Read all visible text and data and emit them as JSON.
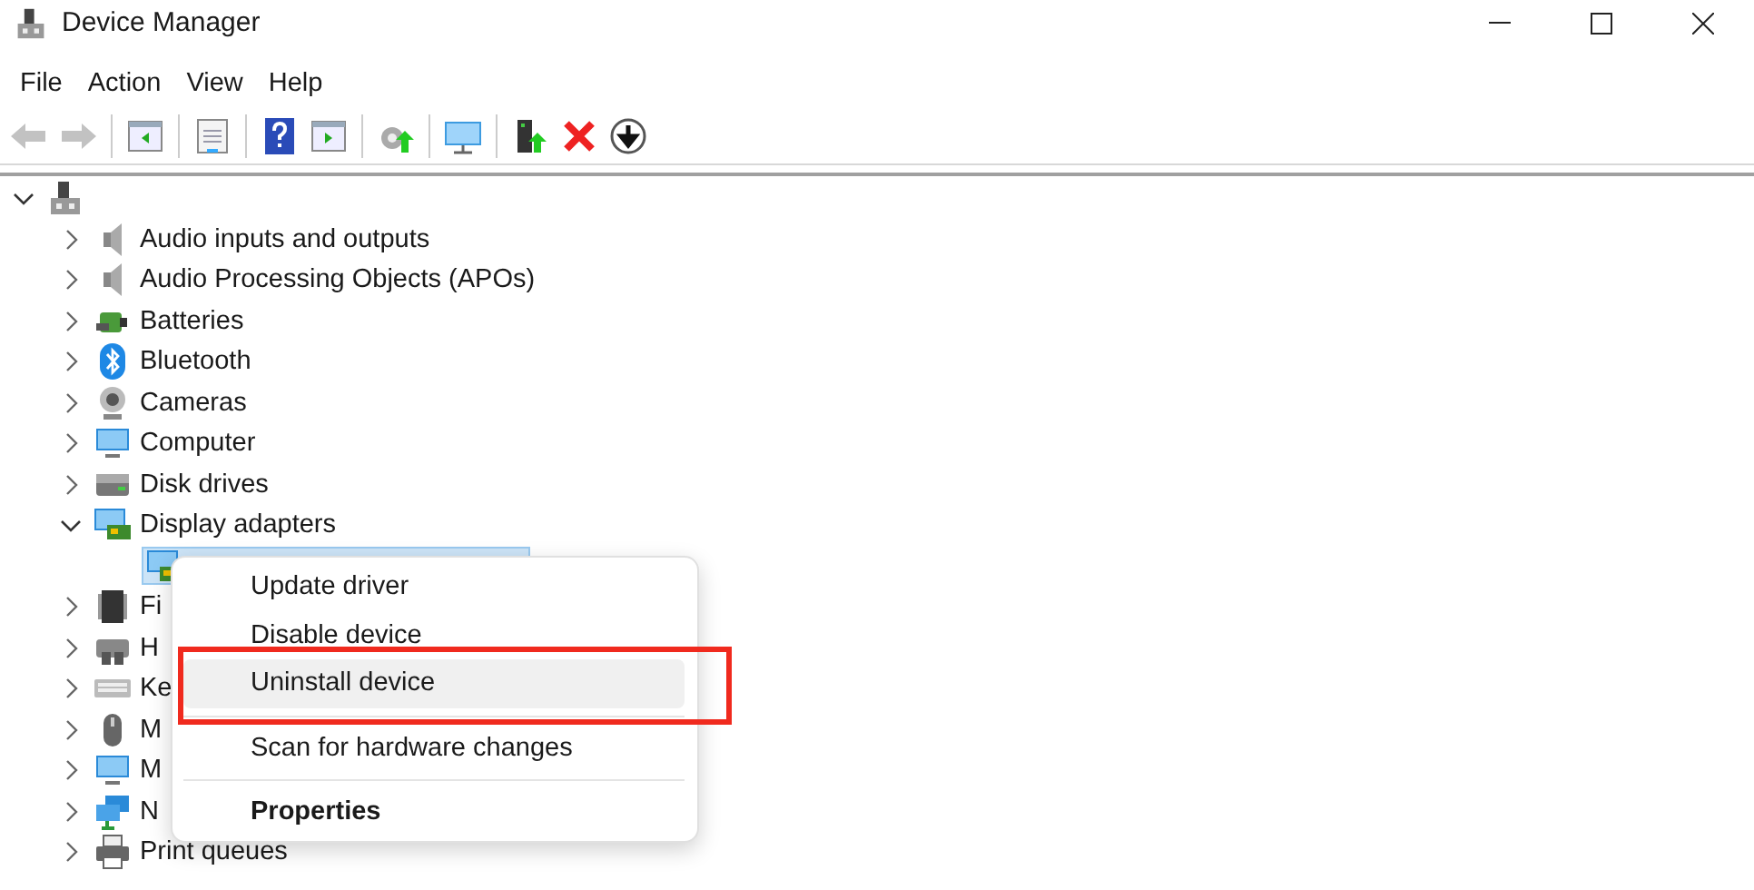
{
  "window": {
    "title": "Device Manager"
  },
  "menu_bar": [
    "File",
    "Action",
    "View",
    "Help"
  ],
  "toolbar": [
    {
      "kind": "back",
      "disabled": true
    },
    {
      "kind": "forward",
      "disabled": true
    },
    {
      "kind": "sep"
    },
    {
      "kind": "console-tree",
      "disabled": false
    },
    {
      "kind": "sep"
    },
    {
      "kind": "properties",
      "disabled": false
    },
    {
      "kind": "sep"
    },
    {
      "kind": "help",
      "disabled": false
    },
    {
      "kind": "action-pane",
      "disabled": false
    },
    {
      "kind": "sep"
    },
    {
      "kind": "update-driver",
      "disabled": false
    },
    {
      "kind": "sep"
    },
    {
      "kind": "scan",
      "disabled": false
    },
    {
      "kind": "sep"
    },
    {
      "kind": "enable",
      "disabled": false
    },
    {
      "kind": "uninstall",
      "disabled": false
    },
    {
      "kind": "disable",
      "disabled": false
    }
  ],
  "tree": {
    "kind": "computer",
    "expanded": true,
    "selected": false,
    "children": [
      {
        "kind": "speaker",
        "label": "Audio inputs and outputs",
        "expanded": false,
        "selected": false
      },
      {
        "kind": "speaker",
        "label": "Audio Processing Objects (APOs)",
        "expanded": false,
        "selected": false
      },
      {
        "kind": "battery",
        "label": "Batteries",
        "expanded": false,
        "selected": false
      },
      {
        "kind": "bluetooth",
        "label": "Bluetooth",
        "expanded": false,
        "selected": false
      },
      {
        "kind": "camera",
        "label": "Cameras",
        "expanded": false,
        "selected": false
      },
      {
        "kind": "monitor",
        "label": "Computer",
        "expanded": false,
        "selected": false
      },
      {
        "kind": "disk",
        "label": "Disk drives",
        "expanded": false,
        "selected": false
      },
      {
        "kind": "adapter",
        "label": "Display adapters",
        "expanded": true,
        "selected": false,
        "children": [
          {
            "kind": "adapter",
            "selected": true
          }
        ]
      },
      {
        "kind": "chip",
        "label": "Fi",
        "expanded": false,
        "selected": false
      },
      {
        "kind": "hid",
        "label": "H",
        "expanded": false,
        "selected": false
      },
      {
        "kind": "keyboard",
        "label": "Ke",
        "expanded": false,
        "selected": false
      },
      {
        "kind": "mouse",
        "label": "M",
        "expanded": false,
        "selected": false
      },
      {
        "kind": "monitor",
        "label": "M",
        "expanded": false,
        "selected": false
      },
      {
        "kind": "network",
        "label": "N",
        "expanded": false,
        "selected": false
      },
      {
        "kind": "printer",
        "label": "Print queues",
        "expanded": false,
        "selected": false
      }
    ]
  },
  "context_menu": [
    {
      "kind": "item",
      "label": "Update driver",
      "hovered": false,
      "highlighted": false,
      "default": false
    },
    {
      "kind": "item",
      "label": "Disable device",
      "hovered": false,
      "highlighted": false,
      "default": false
    },
    {
      "kind": "item",
      "label": "Uninstall device",
      "hovered": true,
      "highlighted": true,
      "default": false
    },
    {
      "kind": "separator"
    },
    {
      "kind": "item",
      "label": "Scan for hardware changes",
      "hovered": false,
      "highlighted": false,
      "default": false
    },
    {
      "kind": "separator"
    },
    {
      "kind": "item",
      "label": "Properties",
      "hovered": false,
      "highlighted": false,
      "default": true
    }
  ]
}
